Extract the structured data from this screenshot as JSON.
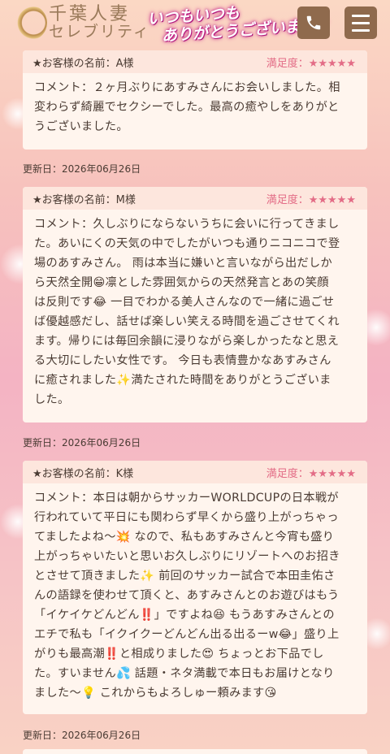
{
  "header": {
    "logo_line1": "千葉人妻",
    "logo_line2": "セレブリティ",
    "slogan_line1": "いつもいつも",
    "slogan_line2": "ありがとうございます",
    "slogan_heart": "♡",
    "phone_icon": "phone-icon",
    "menu_icon": "hamburger-menu-icon"
  },
  "reviews": [
    {
      "name": "★お客様の名前：A様",
      "rating_label": "満足度：",
      "rating_stars": "★★★★★",
      "comment": "コメント：２ヶ月ぶりにあすみさんにお会いしました。相\n変わらず綺麗でセクシーでした。最高の癒やしをありがと\nうございました。",
      "updated": "更新日：2026年06月26日"
    },
    {
      "name": "★お客様の名前：M様",
      "rating_label": "満足度：",
      "rating_stars": "★★★★★",
      "comment": "コメント：久しぶりにならないうちに会いに行ってきまし\nた。あいにくの天気の中でしたがいつも通りニコニコで登\n場のあすみさん。 雨は本当に嫌いと言いながら出だしか\nら天然全開😁凛とした雰囲気からの天然発言とあの笑顔\nは反則です😂 一目でわかる美人さんなので一緒に過ごせ\nば優越感だし、話せば楽しい笑える時間を過ごさせてくれ\nます。帰りには毎回余韻に浸りながら楽しかったなと思え\nる大切にしたい女性です。 今日も表情豊かなあすみさん\nに癒されました✨満たされた時間をありがとうございま\nした。",
      "updated": "更新日：2026年06月26日"
    },
    {
      "name": "★お客様の名前：K様",
      "rating_label": "満足度：",
      "rating_stars": "★★★★★",
      "comment": "コメント：本日は朝からサッカーWORLDCUPの日本戦が\n行われていて平日にも関わらず早くから盛り上がっちゃっ\nてましたよね〜💥 なので、私もあすみさんと今宵も盛り\n上がっちゃいたいと思いお久しぶりにリゾートへのお招き\nとさせて頂きました✨ 前回のサッカー試合で本田圭佑さ\nんの語録を使わせて頂くと、あすみさんとのお遊びはもう\n「イケイケどんどん‼️」ですよね😆 もうあすみさんとの\nエチで私も「イクイクーどんどん出る出るーw😂」盛り上\nがりも最高潮‼️と相成りました😍 ちょっとお下品でし\nた。すいません💦 話題・ネタ満載で本日もお届けとなり\nました〜💡 これからもよろしゅー頼みます😘",
      "updated": "更新日：2026年06月26日"
    }
  ]
}
